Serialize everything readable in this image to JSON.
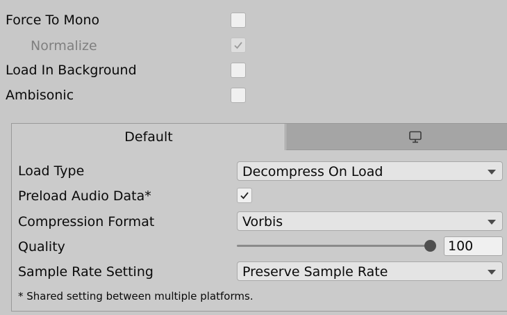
{
  "properties": {
    "force_to_mono": {
      "label": "Force To Mono",
      "checked": false
    },
    "normalize": {
      "label": "Normalize",
      "checked": true,
      "disabled": true
    },
    "load_in_background": {
      "label": "Load In Background",
      "checked": false
    },
    "ambisonic": {
      "label": "Ambisonic",
      "checked": false
    }
  },
  "platform_tabs": {
    "default_label": "Default",
    "standalone_icon": "monitor-icon",
    "active": "Default"
  },
  "settings": {
    "load_type": {
      "label": "Load Type",
      "value": "Decompress On Load"
    },
    "preload_audio_data": {
      "label": "Preload Audio Data*",
      "checked": true
    },
    "compression_format": {
      "label": "Compression Format",
      "value": "Vorbis"
    },
    "quality": {
      "label": "Quality",
      "value": "100",
      "slider_fraction": 1.0
    },
    "sample_rate_setting": {
      "label": "Sample Rate Setting",
      "value": "Preserve Sample Rate"
    }
  },
  "footnote": "* Shared setting between multiple platforms.",
  "colors": {
    "background": "#c8c8c8",
    "inactive_tab": "#a5a5a5",
    "field": "#e4e4e4",
    "text": "#090909",
    "disabled_text": "#7f7f7f"
  }
}
